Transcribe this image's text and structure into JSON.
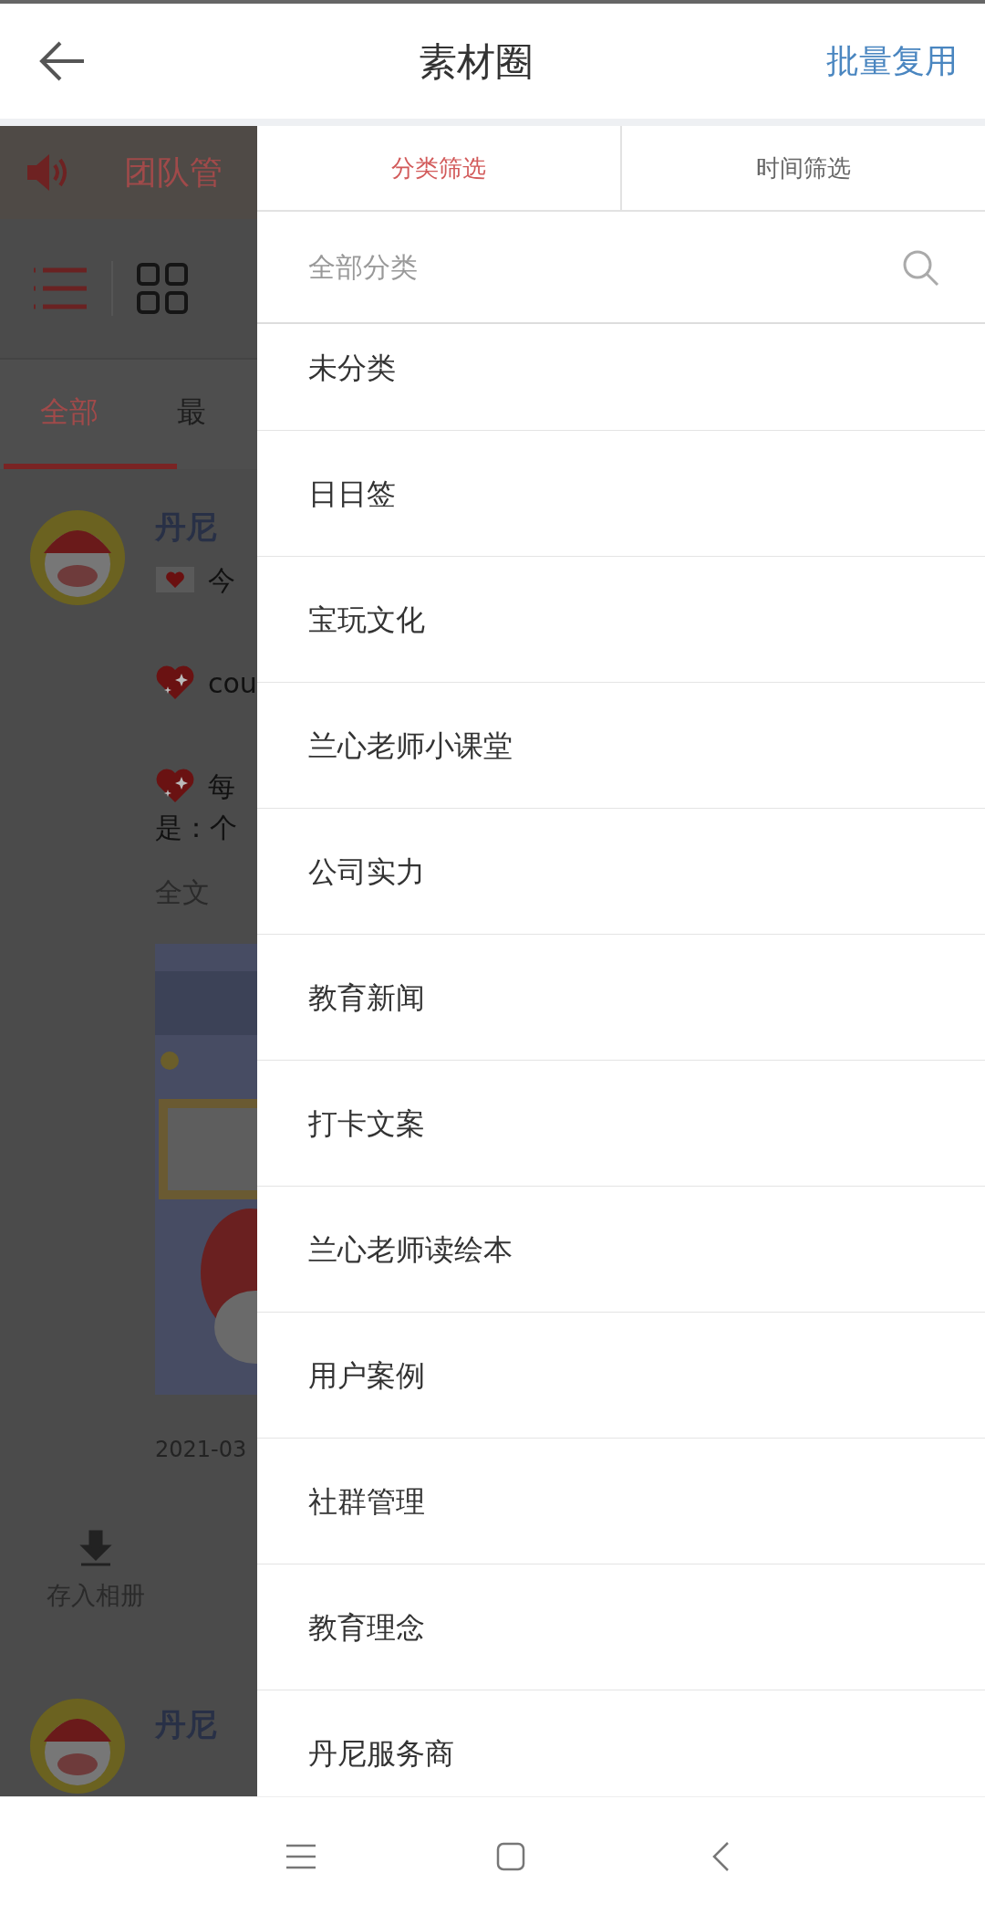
{
  "header": {
    "title": "素材圈",
    "action": "批量复用"
  },
  "background": {
    "notice": "团队管",
    "tabs": [
      {
        "label": "全部",
        "selected": true
      },
      {
        "label": "最",
        "selected": false
      }
    ],
    "post": {
      "author": "丹尼",
      "lines": [
        {
          "kind": "letter",
          "text": "今"
        },
        {
          "kind": "heart",
          "text": "cou"
        },
        {
          "kind": "heart",
          "text": "每"
        },
        {
          "kind": "text",
          "text": "是：个"
        }
      ],
      "more": "全文",
      "date": "2021-03",
      "save": "存入相册"
    },
    "next_author": "丹尼"
  },
  "drawer": {
    "tabs": [
      {
        "label": "分类筛选",
        "selected": true
      },
      {
        "label": "时间筛选",
        "selected": false
      }
    ],
    "search": {
      "placeholder": "全部分类"
    },
    "categories": [
      "未分类",
      "日日签",
      "宝玩文化",
      "兰心老师小课堂",
      "公司实力",
      "教育新闻",
      "打卡文案",
      "兰心老师读绘本",
      "用户案例",
      "社群管理",
      "教育理念",
      "丹尼服务商"
    ]
  }
}
